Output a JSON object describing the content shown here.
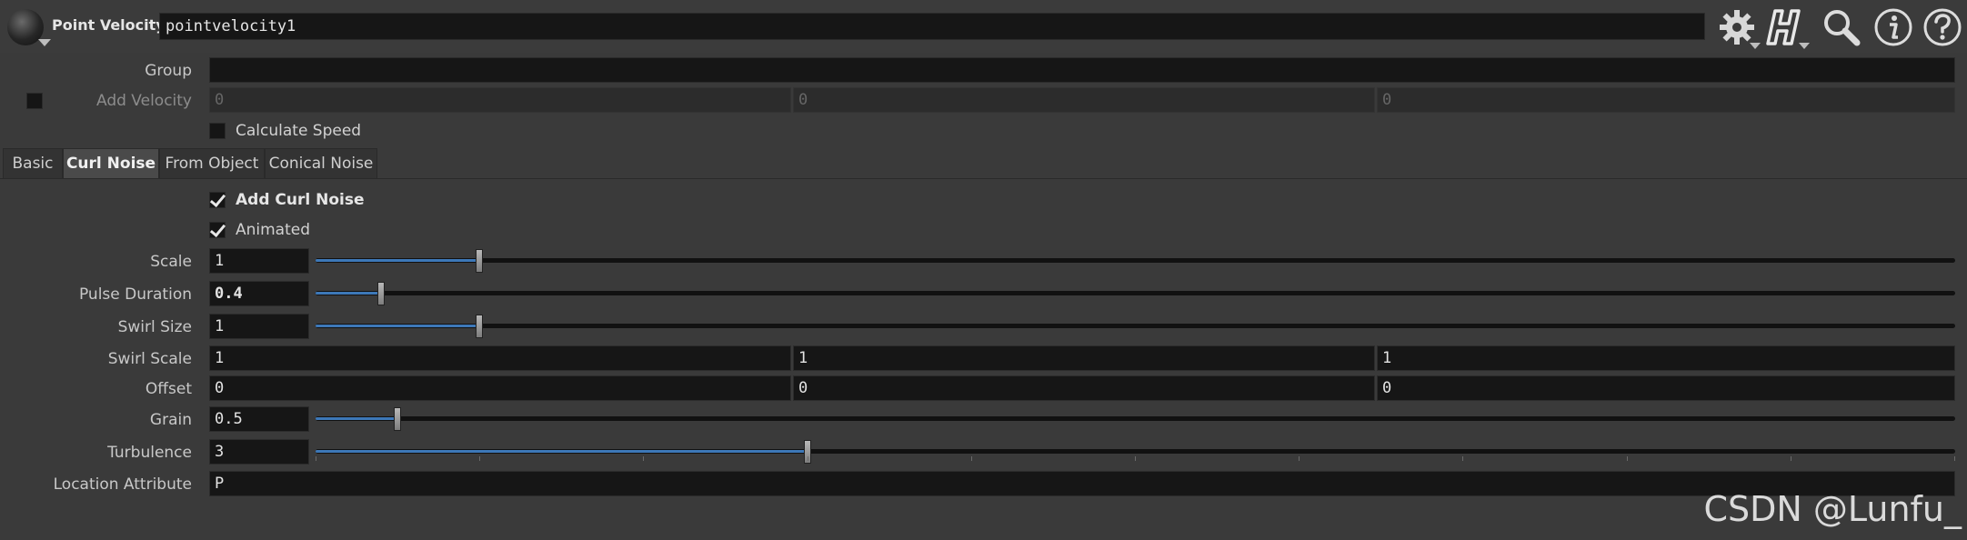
{
  "header": {
    "node_type": "Point Velocity",
    "node_name": "pointvelocity1",
    "icons": [
      "gear-icon",
      "houdini-h-icon",
      "search-icon",
      "info-icon",
      "help-icon"
    ]
  },
  "params_top": {
    "group": {
      "label": "Group",
      "value": ""
    },
    "add_velocity": {
      "label": "Add Velocity",
      "enabled": false,
      "values": [
        "0",
        "0",
        "0"
      ]
    },
    "calculate_speed": {
      "label": "Calculate Speed",
      "checked": false
    }
  },
  "tabs": [
    {
      "label": "Basic",
      "active": false
    },
    {
      "label": "Curl Noise",
      "active": true
    },
    {
      "label": "From Object",
      "active": false
    },
    {
      "label": "Conical Noise",
      "active": false
    }
  ],
  "curl": {
    "add_curl_noise": {
      "label": "Add Curl Noise",
      "checked": true
    },
    "animated": {
      "label": "Animated",
      "checked": true
    },
    "scale": {
      "label": "Scale",
      "value": "1",
      "level": 0.1
    },
    "pulse_duration": {
      "label": "Pulse Duration",
      "value": "0.4",
      "level": 0.04
    },
    "swirl_size": {
      "label": "Swirl Size",
      "value": "1",
      "level": 0.1
    },
    "swirl_scale": {
      "label": "Swirl Scale",
      "values": [
        "1",
        "1",
        "1"
      ]
    },
    "offset": {
      "label": "Offset",
      "values": [
        "0",
        "0",
        "0"
      ]
    },
    "grain": {
      "label": "Grain",
      "value": "0.5",
      "level": 0.05
    },
    "turbulence": {
      "label": "Turbulence",
      "value": "3",
      "level": 0.3
    },
    "location_attribute": {
      "label": "Location Attribute",
      "value": "P"
    }
  },
  "colors": {
    "background": "#3a3a3a",
    "field": "#161616",
    "slider_fill": "#3d78b8"
  },
  "watermark": "CSDN @Lunfu_"
}
